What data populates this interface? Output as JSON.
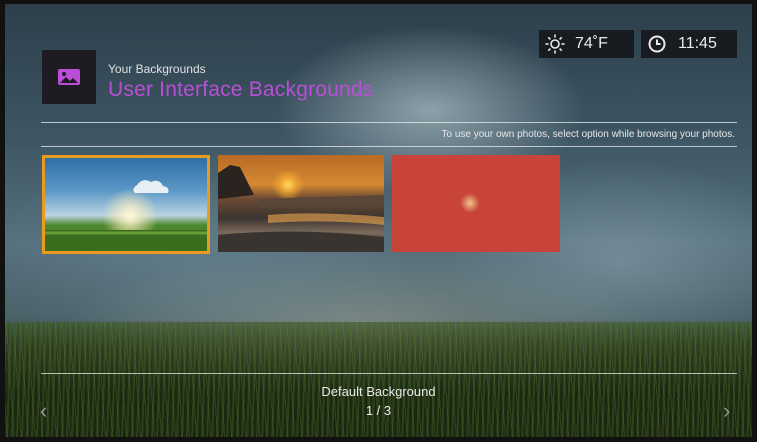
{
  "header": {
    "subtitle": "Your Backgrounds",
    "title": "User Interface Backgrounds",
    "icon": "picture-icon"
  },
  "status": {
    "temperature": "74˚F",
    "weather_icon": "sun-icon",
    "time": "11:45",
    "clock_icon": "clock-icon"
  },
  "hint": "To use your own photos, select option while browsing your photos.",
  "thumbnails": [
    {
      "name": "sunrise-grass",
      "selected": true
    },
    {
      "name": "sunset-beach",
      "selected": false
    },
    {
      "name": "red-flower",
      "selected": false
    }
  ],
  "footer": {
    "label": "Default Background",
    "page": "1 / 3"
  },
  "colors": {
    "accent": "#b94fd6",
    "selection": "#e89b1e"
  }
}
